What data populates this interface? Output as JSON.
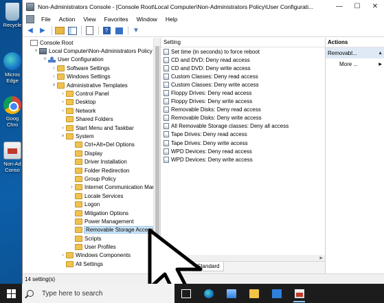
{
  "desktop": {
    "icons": [
      {
        "label": "Recycle"
      },
      {
        "label": "Micros\nEdge"
      },
      {
        "label": "Goog\nChro"
      },
      {
        "label": "Non-Ad\nConso"
      }
    ]
  },
  "window": {
    "title": "Non-Administrators Console - [Console Root\\Local Computer\\Non-Administrators Policy\\User Configurati...",
    "controls": {
      "minimize": "—",
      "maximize": "☐",
      "close": "✕"
    }
  },
  "menu": {
    "items": [
      "File",
      "Action",
      "View",
      "Favorites",
      "Window",
      "Help"
    ]
  },
  "toolbar": {
    "back": "◀",
    "forward": "▶",
    "help": "?",
    "filter": "▼"
  },
  "tree": {
    "items": [
      {
        "label": "Console Root",
        "indent": 0,
        "chevron": "",
        "icon": "root"
      },
      {
        "label": "Local Computer\\Non-Administrators Policy",
        "indent": 1,
        "chevron": "˅",
        "icon": "gpo"
      },
      {
        "label": "User Configuration",
        "indent": 2,
        "chevron": "˅",
        "icon": "user"
      },
      {
        "label": "Software Settings",
        "indent": 3,
        "chevron": "›",
        "icon": "folder"
      },
      {
        "label": "Windows Settings",
        "indent": 3,
        "chevron": "›",
        "icon": "folder"
      },
      {
        "label": "Administrative Templates",
        "indent": 3,
        "chevron": "˅",
        "icon": "folder"
      },
      {
        "label": "Control Panel",
        "indent": 4,
        "chevron": "›",
        "icon": "folder"
      },
      {
        "label": "Desktop",
        "indent": 4,
        "chevron": "›",
        "icon": "folder"
      },
      {
        "label": "Network",
        "indent": 4,
        "chevron": "›",
        "icon": "folder"
      },
      {
        "label": "Shared Folders",
        "indent": 4,
        "chevron": "",
        "icon": "folder"
      },
      {
        "label": "Start Menu and Taskbar",
        "indent": 4,
        "chevron": "›",
        "icon": "folder"
      },
      {
        "label": "System",
        "indent": 4,
        "chevron": "˅",
        "icon": "folder"
      },
      {
        "label": "Ctrl+Alt+Del Options",
        "indent": 5,
        "chevron": "",
        "icon": "folder"
      },
      {
        "label": "Display",
        "indent": 5,
        "chevron": "",
        "icon": "folder"
      },
      {
        "label": "Driver Installation",
        "indent": 5,
        "chevron": "",
        "icon": "folder"
      },
      {
        "label": "Folder Redirection",
        "indent": 5,
        "chevron": "",
        "icon": "folder"
      },
      {
        "label": "Group Policy",
        "indent": 5,
        "chevron": "",
        "icon": "folder"
      },
      {
        "label": "Internet Communication Man",
        "indent": 5,
        "chevron": "›",
        "icon": "folder"
      },
      {
        "label": "Locale Services",
        "indent": 5,
        "chevron": "",
        "icon": "folder"
      },
      {
        "label": "Logon",
        "indent": 5,
        "chevron": "",
        "icon": "folder"
      },
      {
        "label": "Mitigation Options",
        "indent": 5,
        "chevron": "",
        "icon": "folder"
      },
      {
        "label": "Power Management",
        "indent": 5,
        "chevron": "",
        "icon": "folder"
      },
      {
        "label": "Removable Storage Access",
        "indent": 5,
        "chevron": "",
        "icon": "folder",
        "selected": true
      },
      {
        "label": "Scripts",
        "indent": 5,
        "chevron": "",
        "icon": "folder"
      },
      {
        "label": "User Profiles",
        "indent": 5,
        "chevron": "",
        "icon": "folder"
      },
      {
        "label": "Windows Components",
        "indent": 4,
        "chevron": "›",
        "icon": "folder"
      },
      {
        "label": "All Settings",
        "indent": 4,
        "chevron": "",
        "icon": "folder"
      }
    ]
  },
  "content": {
    "column_header": "Setting",
    "settings": [
      "Set time (in seconds) to force reboot",
      "CD and DVD: Deny read access",
      "CD and DVD: Deny write access",
      "Custom Classes: Deny read access",
      "Custom Classes: Deny write access",
      "Floppy Drives: Deny read access",
      "Floppy Drives: Deny write access",
      "Removable Disks: Deny read access",
      "Removable Disks: Deny write access",
      "All Removable Storage classes: Deny all access",
      "Tape Drives: Deny read access",
      "Tape Drives: Deny write access",
      "WPD Devices: Deny read access",
      "WPD Devices: Deny write access"
    ],
    "tab": "Standard"
  },
  "actions": {
    "header": "Actions",
    "section": "Removabl...",
    "more": "More ...",
    "arrow_up": "▲",
    "arrow_right": "▶"
  },
  "status": {
    "text": "14 setting(s)"
  },
  "taskbar": {
    "search_placeholder": "Type here to search"
  },
  "colors": {
    "selection": "#cce4f7",
    "actions_section": "#dfe9f5",
    "taskbar": "#1c1c1c",
    "desktop": "#0c5fa8"
  }
}
